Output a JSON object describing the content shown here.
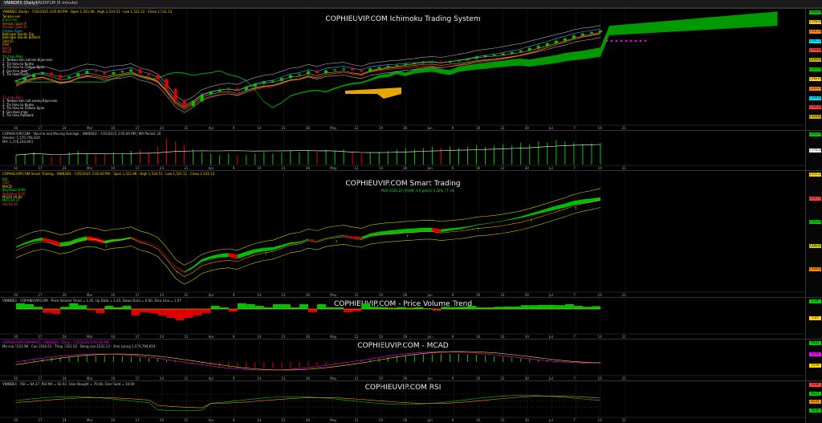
{
  "tabs": [
    "VNINDEX (Daily)",
    "VN30F1M (5 minute)"
  ],
  "colors": {
    "bg": "#000000",
    "green": "#00c800",
    "red": "#e00000",
    "yellow": "#d4d400",
    "orange": "#ff8c00",
    "magenta": "#ff00ff",
    "text": "#dddddd"
  },
  "panes": {
    "ichimoku": {
      "title": "COPHIEUVIP.COM Ichimoku Trading System",
      "header": "VNINDEX (Daily) · 7/25/2025 3:05:00 PM · Open 1,521.96 · High 1,534.51 · Low 1,521.52 · Close 1,531.13",
      "legend": [
        "Tenkan-sen",
        "Kijun-sen",
        "Senkou Span A",
        "Senkou Span B",
        "Chikou Span",
        "Bollinger Bands Top",
        "Bollinger Bands Bottom",
        "SMA20",
        "EMA",
        "MA50",
        "MA20"
      ],
      "text_block_1": [
        "Tin hieu Mua",
        "1. Tenkan-sen cat len Kijun-sen",
        "2. Tin hieu tu Kumo",
        "3. Tin hieu tu Chikou Span",
        "4. Gia tren may",
        "5. Tin hieu manh"
      ],
      "text_block_2": [
        "Tin hieu Ban",
        "1. Tenkan-sen cat xuong Kijun-sen",
        "2. Tin hieu tu Kumo",
        "3. Tin hieu tu Chikou Span",
        "4. Gia duoi may",
        "5. Tin hieu Pullback"
      ]
    },
    "volume": {
      "header": "COPHIEUVIP.COM - Volume and Moving Average - VNINDEX - 7/25/2025 3:05:00 PM | MA Period: 20",
      "line2": "Volume: 1,570,794,624",
      "line3": "MA: 1,376,164,603"
    },
    "smart": {
      "title": "COPHIEUVIP.COM Smart Trading",
      "header": "COPHIEUVIP.COM Smart Trading · VNINDEX · 7/25/2025 3:05:00 PM · Open 1,521.96 · High 1,534.51 · Low 1,521.52 · Close 1,531.13",
      "info": "MUA 1526.22 | Profit: 4.9 points 0.32% | T +8",
      "stats": [
        "RSI",
        "ADX",
        "MACD",
        "BuyValue 0.00",
        "SellValue 0.00",
        "MCDX 49.80",
        "MA5 64.37",
        "RSI 62.02"
      ]
    },
    "pvt": {
      "title": "COPHIEUVIP.COM - Price Volume Trend",
      "header": "VNINDEX - COPHIEUVIP.COM - Price Volume Trend = 1.45, Up Data = 1.45, Down Data = 0.00, Zero Line = 1.07"
    },
    "macd": {
      "title": "COPHIEUVIP.COM - MCAD",
      "header": "COPHIEUVIP.COM MACD - VNINDEX - Daily - 7/25/2025 3:05:00 PM",
      "line2": "Mo cua 1521.96 · Cao 1534.51 · Thap 1521.52 · Dong cua 1531.13 · Khoi Luong 1,570,794,624"
    },
    "rsi": {
      "title": "COPHIEUVIP.COM RSI",
      "header": "VNINDEX - RSI = 64.27, RSI MA = 62.02, Over Bought = 70.00, Over Sold = 30.00"
    }
  },
  "x_labels": [
    "10",
    "17",
    "24",
    "Mar",
    "10",
    "17",
    "24",
    "31",
    "Apr",
    "9",
    "14",
    "21",
    "28",
    "May",
    "12",
    "19",
    "26",
    "Jun",
    "9",
    "16",
    "23",
    "30",
    "Jul",
    "7",
    "14",
    "21"
  ],
  "price_tags": {
    "ichimoku": [
      "1,604.01",
      "1,578.95",
      "1,541.31",
      "1,531.13",
      "1,500.84",
      "1,493.55",
      "1,471.95",
      "1,460.07",
      "1,450.05",
      "1,400.00",
      "1,355.00",
      "1,310.00"
    ],
    "volume": [
      "1,570.79M",
      "1,376.16M"
    ],
    "smart": [
      "1,572.11",
      "1,531.13",
      "1,521.96",
      "1,460.00",
      "1,400.00"
    ],
    "pvt": [
      "1.45",
      "1.07"
    ],
    "macd": [
      "36.41",
      "22.62",
      "13.79"
    ],
    "rsi": [
      "70.00",
      "64.27",
      "62.02",
      "30.00"
    ]
  },
  "chart_data": [
    {
      "type": "candlestick",
      "title": "COPHIEUVIP.COM Ichimoku Trading System",
      "xlabel": "",
      "ylabel": "",
      "close": [
        1272,
        1290,
        1305,
        1312,
        1300,
        1285,
        1292,
        1310,
        1322,
        1318,
        1305,
        1315,
        1320,
        1330,
        1310,
        1300,
        1280,
        1230,
        1170,
        1140,
        1165,
        1200,
        1215,
        1225,
        1230,
        1222,
        1240,
        1255,
        1265,
        1270,
        1285,
        1300,
        1305,
        1320,
        1310,
        1325,
        1330,
        1335,
        1325,
        1318,
        1335,
        1342,
        1348,
        1352,
        1358,
        1362,
        1368,
        1370,
        1365,
        1372,
        1378,
        1385,
        1395,
        1400,
        1405,
        1412,
        1420,
        1428,
        1440,
        1452,
        1465,
        1478,
        1490,
        1505,
        1515,
        1522,
        1531
      ],
      "ylim": [
        1070,
        1610
      ]
    },
    {
      "type": "bar",
      "title": "Volume and Moving Average",
      "values_bn": [
        0.7,
        0.8,
        0.9,
        0.7,
        0.6,
        0.7,
        0.9,
        1.0,
        0.8,
        0.7,
        0.8,
        0.9,
        0.8,
        1.0,
        1.1,
        0.9,
        1.3,
        1.9,
        1.7,
        1.4,
        1.1,
        0.9,
        0.8,
        0.7,
        0.8,
        0.7,
        0.7,
        0.8,
        0.9,
        0.8,
        0.9,
        1.0,
        0.9,
        1.0,
        0.9,
        1.0,
        1.0,
        1.1,
        0.9,
        0.8,
        0.9,
        0.9,
        1.0,
        1.1,
        1.2,
        1.1,
        1.2,
        1.3,
        1.2,
        1.3,
        1.2,
        1.3,
        1.4,
        1.3,
        1.4,
        1.5,
        1.4,
        1.6,
        1.5,
        1.7,
        1.6,
        1.8,
        1.7,
        1.6,
        1.5,
        1.55,
        1.57
      ]
    },
    {
      "type": "area",
      "title": "COPHIEUVIP.COM Smart Trading"
    },
    {
      "type": "area",
      "title": "COPHIEUVIP.COM - Price Volume Trend"
    },
    {
      "type": "bar",
      "title": "COPHIEUVIP.COM - MCAD"
    },
    {
      "type": "line",
      "title": "COPHIEUVIP.COM RSI",
      "ylim": [
        0,
        100
      ]
    }
  ]
}
